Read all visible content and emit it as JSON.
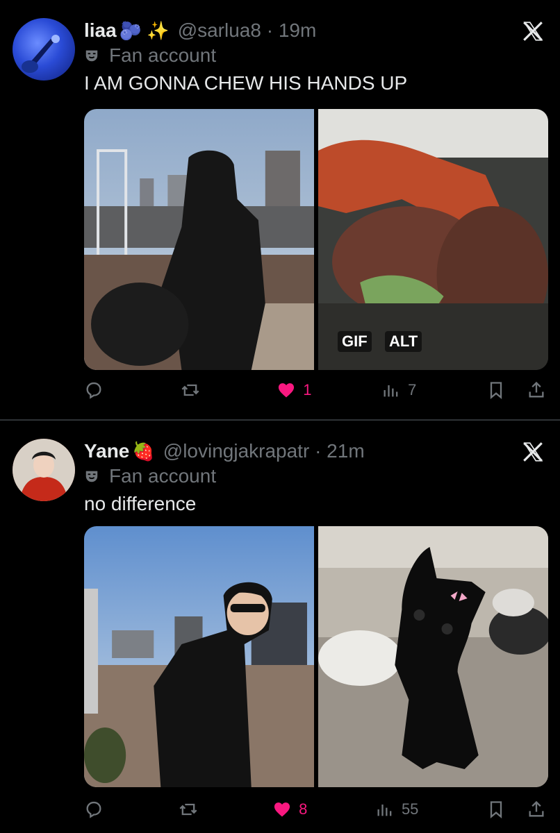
{
  "tweets": [
    {
      "name": "liaa",
      "name_emojis": "🫐 ✨",
      "handle": "@sarlua8 · 19m",
      "label": "Fan account",
      "text": "I AM GONNA CHEW HIS HANDS UP",
      "media_badges": {
        "gif": "GIF",
        "alt": "ALT"
      },
      "actions": {
        "replies": "",
        "reposts": "",
        "likes": "1",
        "views": "7"
      },
      "liked": true
    },
    {
      "name": "Yane",
      "name_emojis": "🍓",
      "handle": "@lovingjakrapatr · 21m",
      "label": "Fan account",
      "text": "no difference",
      "actions": {
        "replies": "",
        "reposts": "",
        "likes": "8",
        "views": "55"
      },
      "liked": true
    }
  ],
  "colors": {
    "background": "#000000",
    "text": "#e7e9ea",
    "muted": "#71767b",
    "like": "#f91880",
    "divider": "#2f3336"
  }
}
